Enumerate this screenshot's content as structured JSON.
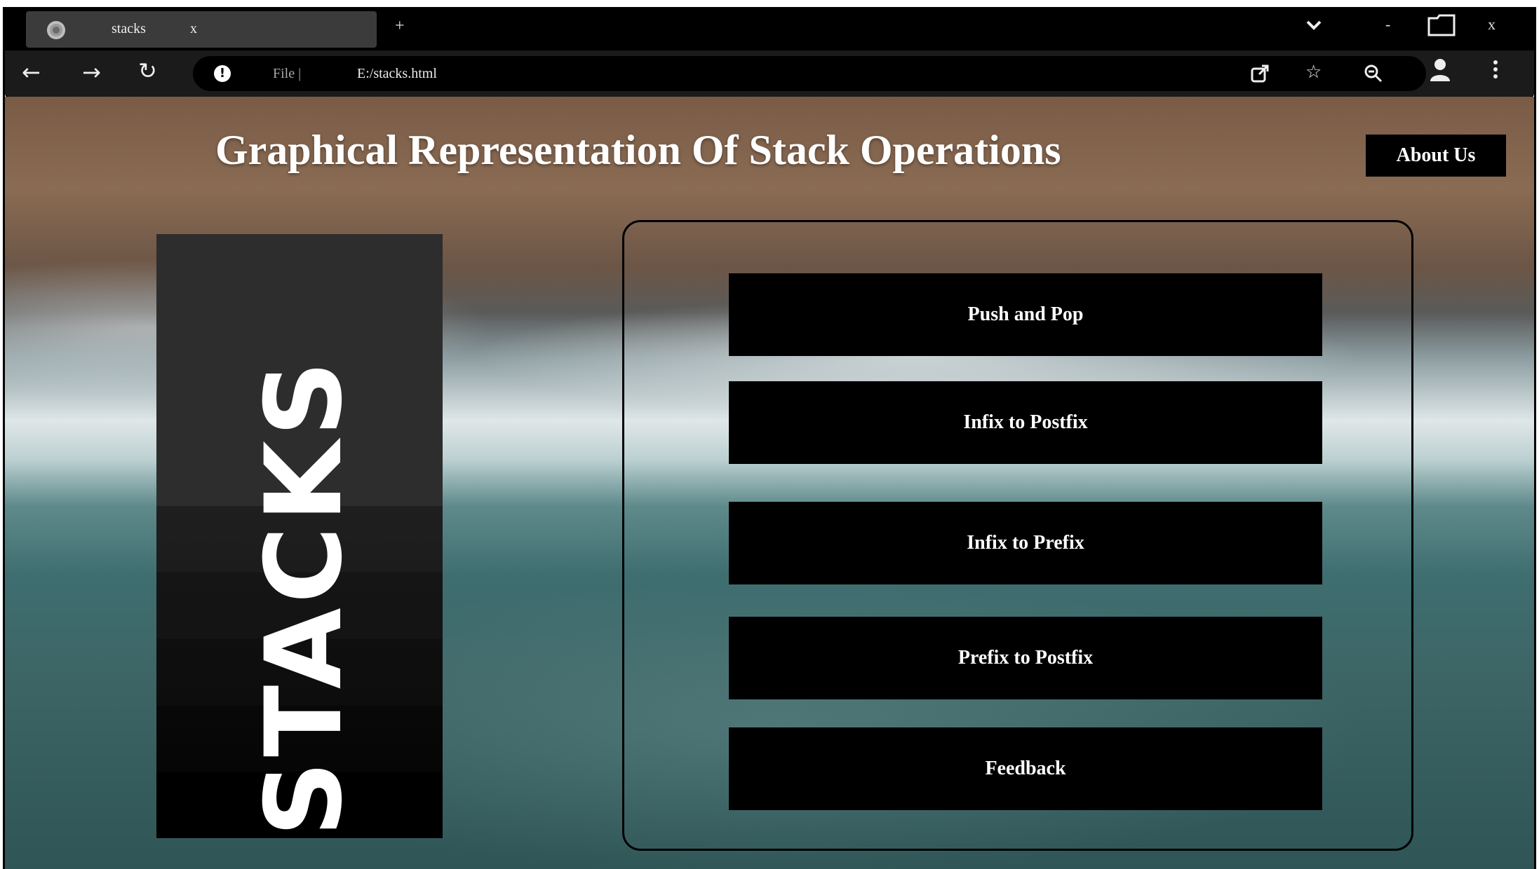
{
  "browser": {
    "tab_title": "stacks",
    "tab_close": "x",
    "new_tab": "+",
    "window_controls": {
      "dropdown": "⌄",
      "minimize": "-",
      "maximize": "▭",
      "close": "x"
    },
    "address": {
      "scheme": "File |",
      "url": "E:/stacks.html"
    },
    "icons": [
      "back-arrow-icon",
      "forward-arrow-icon",
      "reload-icon",
      "info-icon",
      "share-icon",
      "star-icon",
      "zoom-out-icon",
      "profile-icon",
      "menu-dots-icon"
    ]
  },
  "page": {
    "heading": "Graphical Representation Of Stack Operations",
    "about_label": "About Us",
    "side_word": "STACKS",
    "menu": [
      {
        "label": "Push and Pop"
      },
      {
        "label": "Infix to Postfix"
      },
      {
        "label": "Infix to Prefix"
      },
      {
        "label": "Prefix to Postfix"
      },
      {
        "label": "Feedback"
      }
    ]
  },
  "colors": {
    "chrome_bg": "#000000",
    "toolbar_bg": "#1b1b1b",
    "button_bg": "#000000",
    "text": "#ffffff"
  }
}
